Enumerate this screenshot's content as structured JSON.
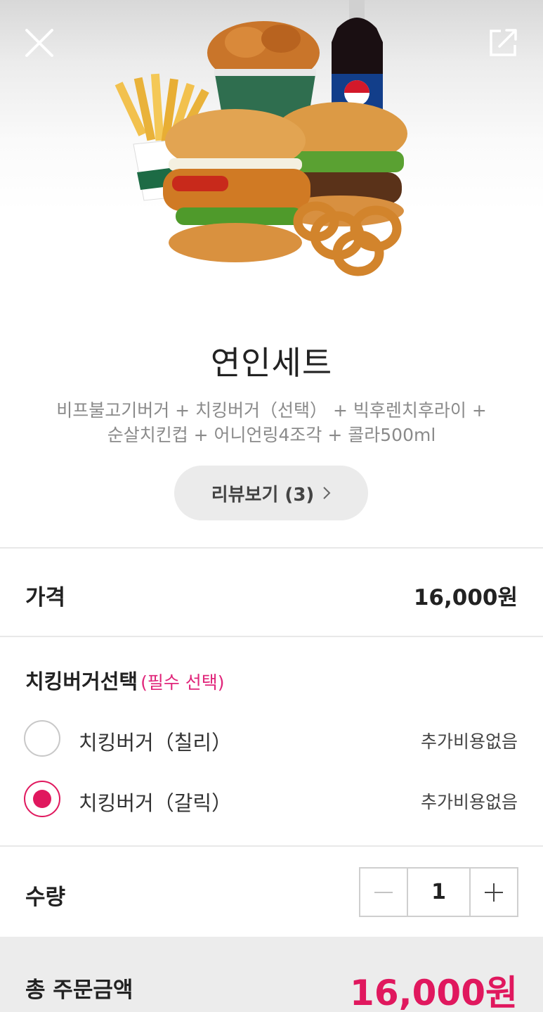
{
  "header": {
    "close_icon": "close-icon",
    "share_icon": "share-icon"
  },
  "product": {
    "name": "연인세트",
    "description_line1": "비프불고기버거 + 치킹버거（선택） + 빅후렌치후라이 +",
    "description_line2": "순살치킨컵 + 어니언링4조각 + 콜라500ml",
    "review_label": "리뷰보기 (3)"
  },
  "price": {
    "label": "가격",
    "value": "16,000원"
  },
  "options": {
    "title": "치킹버거선택",
    "required": "(필수 선택)",
    "items": [
      {
        "label": "치킹버거（칠리）",
        "price": "추가비용없음",
        "selected": false
      },
      {
        "label": "치킹버거（갈릭）",
        "price": "추가비용없음",
        "selected": true
      }
    ]
  },
  "quantity": {
    "label": "수량",
    "value": "1"
  },
  "total": {
    "label": "총 주문금액",
    "value": "16,000원"
  },
  "colors": {
    "accent": "#e0185e",
    "required": "#e0257a",
    "muted": "#8a8a8a"
  }
}
